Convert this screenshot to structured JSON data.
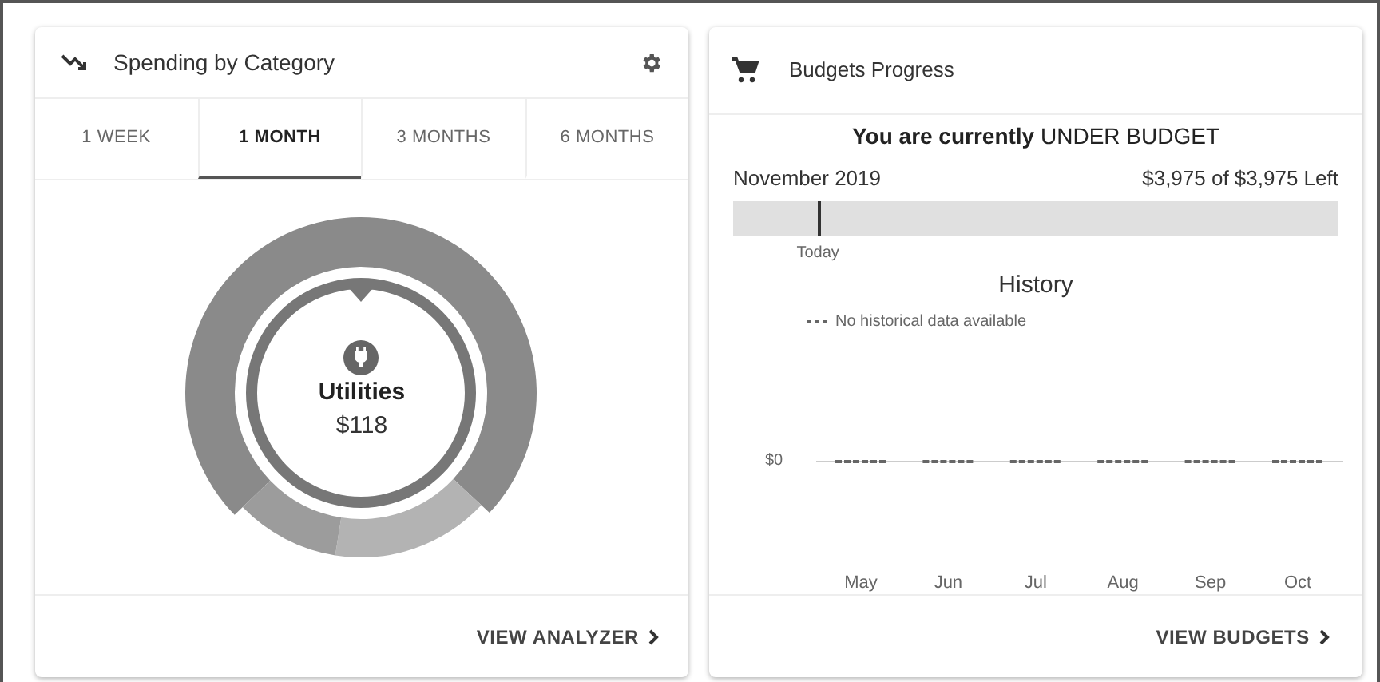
{
  "spending_card": {
    "title": "Spending by Category",
    "tabs": [
      {
        "label": "1 WEEK",
        "selected": false
      },
      {
        "label": "1 MONTH",
        "selected": true
      },
      {
        "label": "3 MONTHS",
        "selected": false
      },
      {
        "label": "6 MONTHS",
        "selected": false
      }
    ],
    "donut": {
      "segments": [
        {
          "color": "#8a8a8a",
          "selected": true
        },
        {
          "color": "#b3b3b3",
          "selected": false
        },
        {
          "color": "#9c9c9c",
          "selected": false
        }
      ],
      "category": "Utilities",
      "amount": "$118"
    },
    "footer_button": "VIEW ANALYZER"
  },
  "budgets_card": {
    "title": "Budgets Progress",
    "status": "**You are currently** UNDER BUDGET",
    "month": "November 2019",
    "remaining": "$3,975 of $3,975 Left",
    "progress": {
      "level": 0
    },
    "today": {
      "label": "Today",
      "level": 0.14
    },
    "history": {
      "title": "History",
      "legend": "No historical data available",
      "y_tick": "$0",
      "months": [
        "May",
        "Jun",
        "Jul",
        "Aug",
        "Sep",
        "Oct"
      ]
    },
    "footer_button": "VIEW BUDGETS"
  }
}
